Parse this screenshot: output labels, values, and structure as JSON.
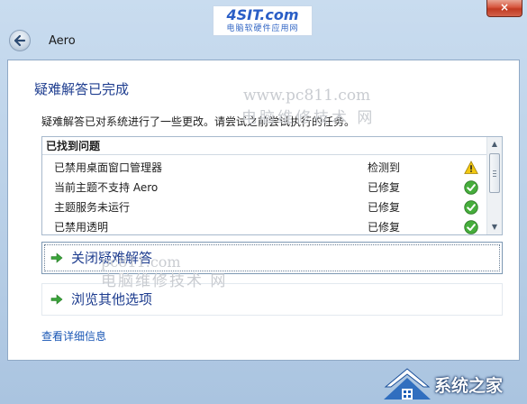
{
  "watermark": {
    "logo_text": "4SIT.com",
    "logo_sub": "电脑软硬件应用网",
    "url": "www.pc811.com",
    "site_name": "电脑维修技术 网",
    "url_partial": "pc811.com",
    "site_name_2": "电脑维修技术 网"
  },
  "window": {
    "title": "Aero",
    "close_glyph": "×"
  },
  "content": {
    "heading": "疑难解答已完成",
    "description": "疑难解答已对系统进行了一些更改。请尝试之前尝试执行的任务。"
  },
  "problems": {
    "header": "已找到问题",
    "rows": [
      {
        "name": "已禁用桌面窗口管理器",
        "status": "检测到",
        "icon": "warning-icon"
      },
      {
        "name": "当前主题不支持 Aero",
        "status": "已修复",
        "icon": "check-icon"
      },
      {
        "name": "主题服务未运行",
        "status": "已修复",
        "icon": "check-icon"
      },
      {
        "name": "已禁用透明",
        "status": "已修复",
        "icon": "check-icon"
      }
    ]
  },
  "commands": {
    "close": "关闭疑难解答",
    "browse": "浏览其他选项"
  },
  "links": {
    "details": "查看详细信息"
  },
  "badge": {
    "text": "系统之家"
  },
  "colors": {
    "heading": "#1e3d8f",
    "link": "#1a57b5",
    "check": "#3aa33a",
    "warning": "#f1c40f",
    "close_button": "#c13a22"
  }
}
